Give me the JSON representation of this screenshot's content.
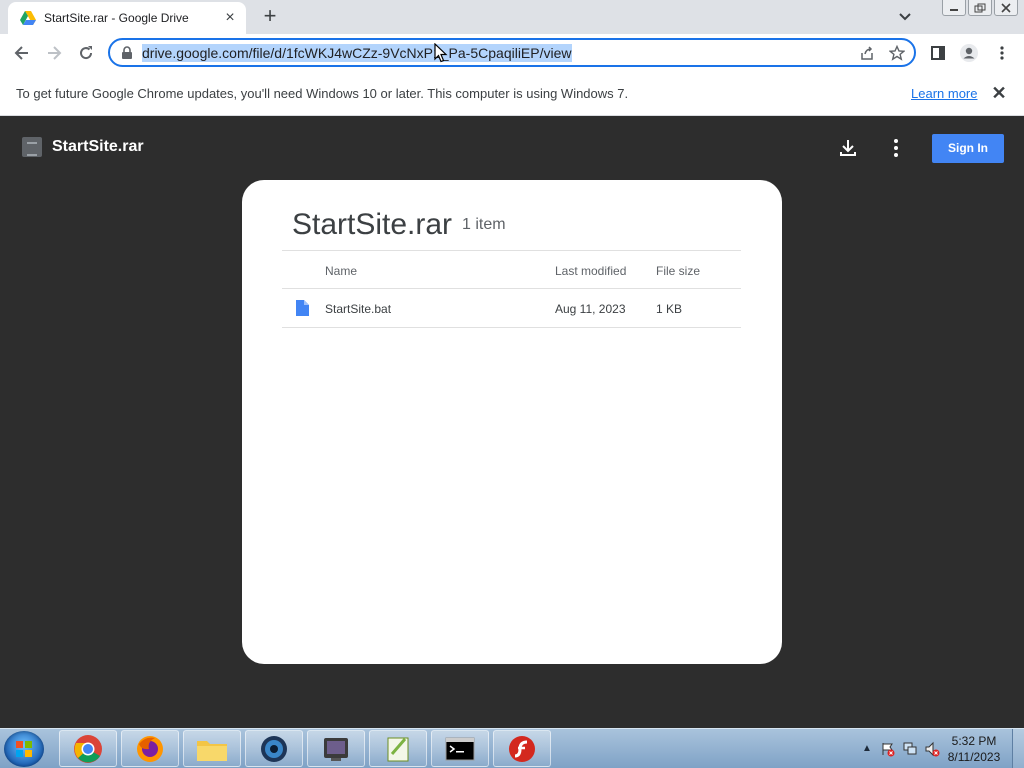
{
  "browser": {
    "tab_title": "StartSite.rar - Google Drive",
    "new_tab_label": "+",
    "url": "drive.google.com/file/d/1fcWKJ4wCZz-9VcNxP1_Pa-5CpaqiliEP/view"
  },
  "infobar": {
    "message": "To get future Google Chrome updates, you'll need Windows 10 or later. This computer is using Windows 7.",
    "link": "Learn more",
    "close": "✕"
  },
  "viewer": {
    "title": "StartSite.rar",
    "signin_label": "Sign In"
  },
  "archive": {
    "title": "StartSite.rar",
    "count": "1 item",
    "columns": [
      "Name",
      "Last modified",
      "File size"
    ],
    "rows": [
      {
        "name": "StartSite.bat",
        "modified": "Aug 11, 2023",
        "size": "1 KB"
      }
    ]
  },
  "taskbar": {
    "apps": [
      "chrome-icon",
      "firefox-icon",
      "file-explorer-icon",
      "media-player-icon",
      "virtualbox-icon",
      "notepad-plus-icon",
      "command-prompt-icon",
      "flash-icon"
    ],
    "time": "5:32 PM",
    "date": "8/11/2023"
  },
  "colors": {
    "accent": "#1a73e8",
    "signin": "#4285f4",
    "viewer_bg": "#2d2d2d"
  }
}
